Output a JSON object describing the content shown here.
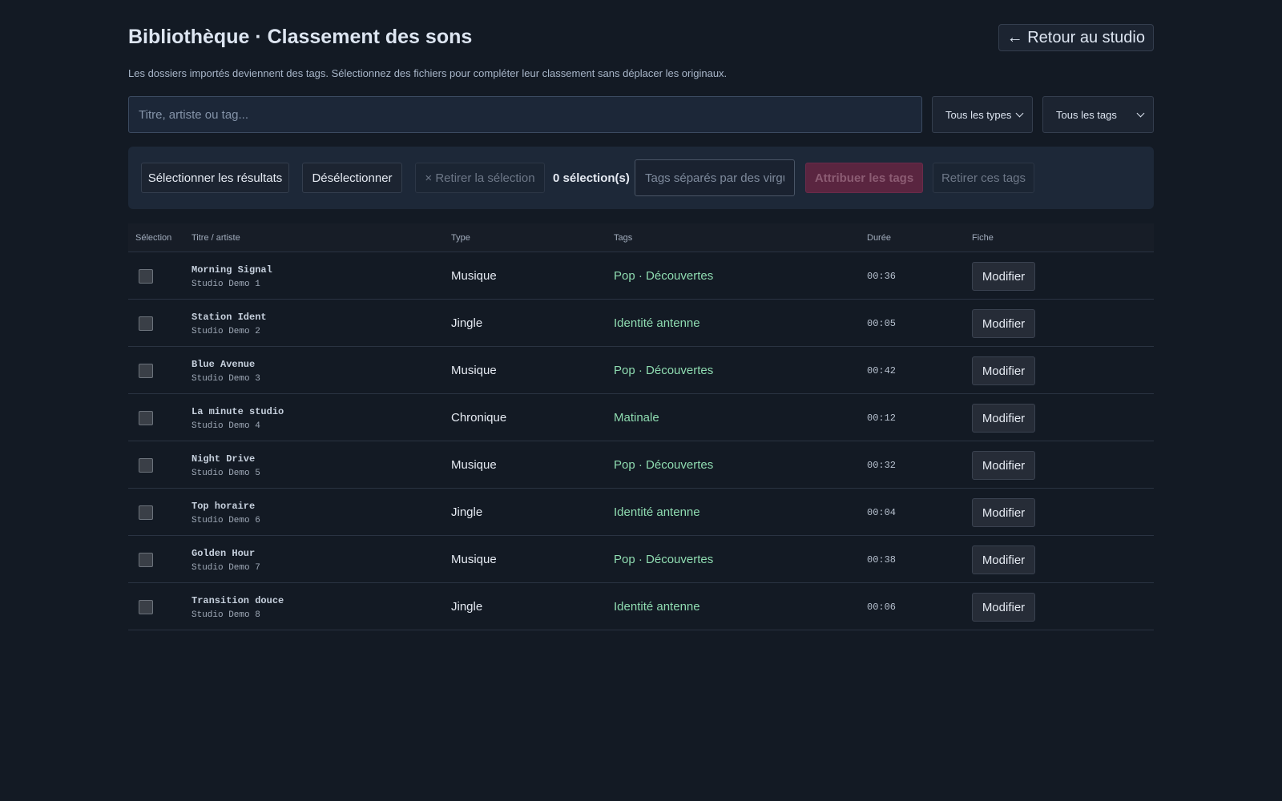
{
  "header": {
    "title": "Bibliothèque · Classement des sons",
    "back_label": "← Retour au studio",
    "subtitle": "Les dossiers importés deviennent des tags. Sélectionnez des fichiers pour compléter leur classement sans déplacer les originaux."
  },
  "filters": {
    "search_placeholder": "Titre, artiste ou tag...",
    "search_value": "",
    "type_select": "Tous les types",
    "tag_select": "Tous les tags"
  },
  "toolbar": {
    "select_results_label": "Sélectionner les résultats",
    "deselect_label": "Désélectionner",
    "remove_selection_label": "× Retirer la sélection",
    "selection_count": "0 sélection(s)",
    "tags_placeholder": "Tags séparés par des virgules",
    "assign_label": "Attribuer les tags",
    "remove_tags_label": "Retirer ces tags"
  },
  "table": {
    "columns": {
      "selection": "Sélection",
      "title": "Titre / artiste",
      "type": "Type",
      "tags": "Tags",
      "duration": "Durée",
      "sheet": "Fiche"
    },
    "edit_label": "Modifier",
    "rows": [
      {
        "title": "Morning Signal",
        "artist": "Studio Demo 1",
        "type": "Musique",
        "tags": "Pop · Découvertes",
        "duration": "00:36",
        "selected": false
      },
      {
        "title": "Station Ident",
        "artist": "Studio Demo 2",
        "type": "Jingle",
        "tags": "Identité antenne",
        "duration": "00:05",
        "selected": false
      },
      {
        "title": "Blue Avenue",
        "artist": "Studio Demo 3",
        "type": "Musique",
        "tags": "Pop · Découvertes",
        "duration": "00:42",
        "selected": false
      },
      {
        "title": "La minute studio",
        "artist": "Studio Demo 4",
        "type": "Chronique",
        "tags": "Matinale",
        "duration": "00:12",
        "selected": false
      },
      {
        "title": "Night Drive",
        "artist": "Studio Demo 5",
        "type": "Musique",
        "tags": "Pop · Découvertes",
        "duration": "00:32",
        "selected": false
      },
      {
        "title": "Top horaire",
        "artist": "Studio Demo 6",
        "type": "Jingle",
        "tags": "Identité antenne",
        "duration": "00:04",
        "selected": false
      },
      {
        "title": "Golden Hour",
        "artist": "Studio Demo 7",
        "type": "Musique",
        "tags": "Pop · Découvertes",
        "duration": "00:38",
        "selected": false
      },
      {
        "title": "Transition douce",
        "artist": "Studio Demo 8",
        "type": "Jingle",
        "tags": "Identité antenne",
        "duration": "00:06",
        "selected": false
      }
    ]
  },
  "colors": {
    "background": "#131a24",
    "tag_text": "#8fdcb1",
    "assign_button": "#5a2540"
  }
}
